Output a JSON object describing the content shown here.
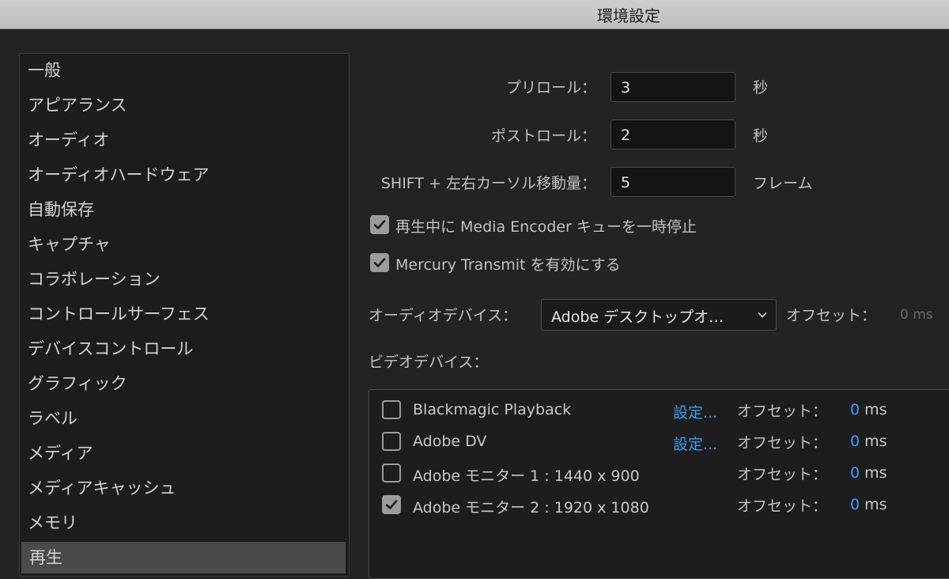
{
  "window": {
    "title": "環境設定"
  },
  "sidebar": {
    "items": [
      {
        "label": "一般"
      },
      {
        "label": "アピアランス"
      },
      {
        "label": "オーディオ"
      },
      {
        "label": "オーディオハードウェア"
      },
      {
        "label": "自動保存"
      },
      {
        "label": "キャプチャ"
      },
      {
        "label": "コラボレーション"
      },
      {
        "label": "コントロールサーフェス"
      },
      {
        "label": "デバイスコントロール"
      },
      {
        "label": "グラフィック"
      },
      {
        "label": "ラベル"
      },
      {
        "label": "メディア"
      },
      {
        "label": "メディアキャッシュ"
      },
      {
        "label": "メモリ"
      },
      {
        "label": "再生"
      }
    ],
    "selected": "再生"
  },
  "playback": {
    "preroll": {
      "label": "プリロール：",
      "value": "3",
      "unit": "秒"
    },
    "postroll": {
      "label": "ポストロール：",
      "value": "2",
      "unit": "秒"
    },
    "shift_step": {
      "label": "SHIFT + 左右カーソル移動量：",
      "value": "5",
      "unit": "フレーム"
    },
    "pause_media_encoder": {
      "label": "再生中に Media Encoder キューを一時停止",
      "checked": true
    },
    "mercury_transmit": {
      "label": "Mercury Transmit を有効にする",
      "checked": true
    },
    "audio_device": {
      "label": "オーディオデバイス：",
      "selected": "Adobe デスクトップオ…",
      "offset_label": "オフセット：",
      "offset_value": "0 ms"
    },
    "video_devices_label": "ビデオデバイス：",
    "video_devices": [
      {
        "name": "Blackmagic Playback",
        "checked": false,
        "settings": "設定...",
        "offset_label": "オフセット：",
        "offset_num": "0",
        "offset_unit": " ms"
      },
      {
        "name": "Adobe DV",
        "checked": false,
        "settings": "設定...",
        "offset_label": "オフセット：",
        "offset_num": "0",
        "offset_unit": " ms"
      },
      {
        "name": "Adobe モニター 1 : 1440 x 900",
        "checked": false,
        "settings": "",
        "offset_label": "オフセット：",
        "offset_num": "0",
        "offset_unit": " ms"
      },
      {
        "name": "Adobe モニター 2 : 1920 x 1080",
        "checked": true,
        "settings": "",
        "offset_label": "オフセット：",
        "offset_num": "0",
        "offset_unit": " ms"
      }
    ]
  }
}
